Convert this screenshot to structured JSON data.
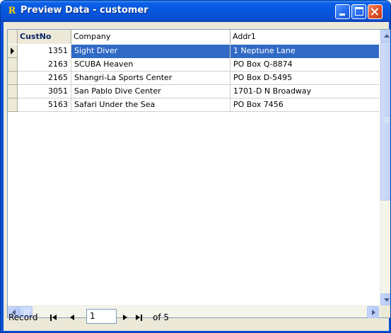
{
  "window": {
    "title": "Preview Data - customer",
    "app_icon_glyph": "R"
  },
  "grid": {
    "columns": [
      {
        "key": "custno",
        "label": "CustNo"
      },
      {
        "key": "company",
        "label": "Company"
      },
      {
        "key": "addr1",
        "label": "Addr1"
      }
    ],
    "rows": [
      {
        "custno": "1351",
        "company": "Sight Diver",
        "addr1": "1 Neptune Lane"
      },
      {
        "custno": "2163",
        "company": "SCUBA Heaven",
        "addr1": "PO Box Q-8874"
      },
      {
        "custno": "2165",
        "company": "Shangri-La Sports Center",
        "addr1": "PO Box D-5495"
      },
      {
        "custno": "3051",
        "company": "San Pablo Dive Center",
        "addr1": "1701-D N Broadway"
      },
      {
        "custno": "5163",
        "company": "Safari Under the Sea",
        "addr1": "PO Box 7456"
      }
    ],
    "selected_row_index": 0
  },
  "navigator": {
    "record_label": "Record",
    "current_record": "1",
    "of_label": "of 5"
  },
  "colors": {
    "selection": "#316ac5",
    "titlebar": "#0656de",
    "client_bg": "#ece9d8"
  }
}
